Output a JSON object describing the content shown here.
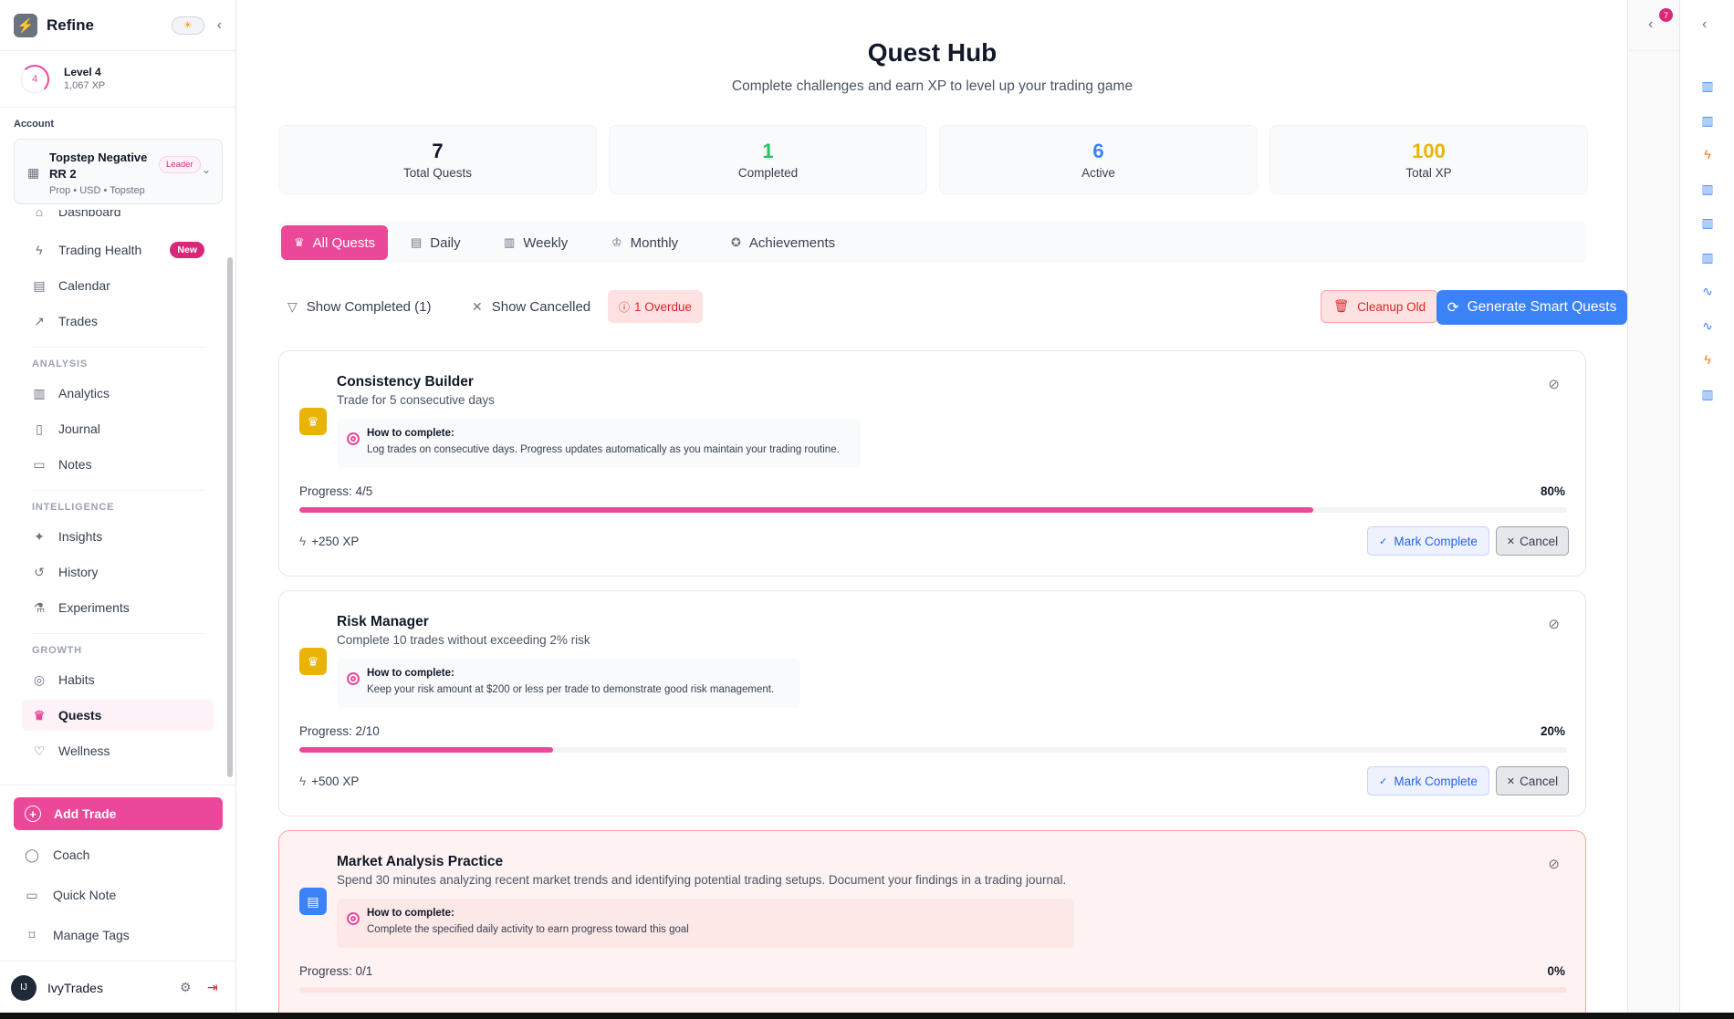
{
  "app": {
    "title": "Refine",
    "theme_icon": "sun-icon"
  },
  "user_level": {
    "ring_value": "4",
    "level": "Level 4",
    "xp": "1,067 XP"
  },
  "account": {
    "label": "Account",
    "name": "Topstep Negative RR 2",
    "badge": "Leader",
    "sub": "Prop • USD • Topstep"
  },
  "nav": {
    "main": [
      {
        "label": "Dashboard",
        "icon": "home-icon"
      },
      {
        "label": "Trading Health",
        "icon": "zap-icon",
        "badge": "New"
      },
      {
        "label": "Calendar",
        "icon": "calendar-icon"
      },
      {
        "label": "Trades",
        "icon": "trending-up-icon"
      }
    ],
    "analysis_title": "ANALYSIS",
    "analysis": [
      {
        "label": "Analytics",
        "icon": "bar-chart-icon"
      },
      {
        "label": "Journal",
        "icon": "book-icon"
      },
      {
        "label": "Notes",
        "icon": "file-icon"
      }
    ],
    "intelligence_title": "INTELLIGENCE",
    "intelligence": [
      {
        "label": "Insights",
        "icon": "sparkles-icon"
      },
      {
        "label": "History",
        "icon": "history-icon"
      },
      {
        "label": "Experiments",
        "icon": "flask-icon"
      }
    ],
    "growth_title": "GROWTH",
    "growth": [
      {
        "label": "Habits",
        "icon": "target-icon"
      },
      {
        "label": "Quests",
        "icon": "trophy-icon"
      },
      {
        "label": "Wellness",
        "icon": "heart-icon"
      }
    ]
  },
  "bottom": {
    "add_trade": "Add Trade",
    "coach": "Coach",
    "quick_note": "Quick Note",
    "manage_tags": "Manage Tags"
  },
  "user": {
    "name": "IvyTrades",
    "avatar": "IJ"
  },
  "header": {
    "title": "Quest Hub",
    "subtitle": "Complete challenges and earn XP to level up your trading game"
  },
  "stats": [
    {
      "value": "7",
      "label": "Total Quests",
      "color": "#111827"
    },
    {
      "value": "1",
      "label": "Completed",
      "color": "#22c55e"
    },
    {
      "value": "6",
      "label": "Active",
      "color": "#3b82f6"
    },
    {
      "value": "100",
      "label": "Total XP",
      "color": "#eab308"
    }
  ],
  "tabs": [
    {
      "label": "All Quests",
      "icon": "trophy-icon"
    },
    {
      "label": "Daily",
      "icon": "calendar-icon"
    },
    {
      "label": "Weekly",
      "icon": "bar-chart-icon"
    },
    {
      "label": "Monthly",
      "icon": "crown-icon"
    },
    {
      "label": "Achievements",
      "icon": "award-icon"
    }
  ],
  "filters": {
    "show_completed": "Show Completed (1)",
    "show_cancelled": "Show Cancelled",
    "overdue": "1 Overdue",
    "cleanup": "Cleanup Old",
    "generate": "Generate Smart Quests"
  },
  "quests": [
    {
      "title": "Consistency Builder",
      "description": "Trade for 5 consecutive days",
      "howto_title": "How to complete:",
      "howto_text": "Log trades on consecutive days. Progress updates automatically as you maintain your trading routine.",
      "progress_label": "Progress: 4/5",
      "progress_pct": "80%",
      "progress_value": 0.8,
      "xp": "+250 XP",
      "mark_complete": "Mark Complete",
      "cancel": "Cancel",
      "icon": "trophy-icon",
      "icon_color": "#eab308"
    },
    {
      "title": "Risk Manager",
      "description": "Complete 10 trades without exceeding 2% risk",
      "howto_title": "How to complete:",
      "howto_text": "Keep your risk amount at $200 or less per trade to demonstrate good risk management.",
      "progress_label": "Progress: 2/10",
      "progress_pct": "20%",
      "progress_value": 0.2,
      "xp": "+500 XP",
      "mark_complete": "Mark Complete",
      "cancel": "Cancel",
      "icon": "trophy-icon",
      "icon_color": "#eab308"
    },
    {
      "title": "Market Analysis Practice",
      "description": "Spend 30 minutes analyzing recent market trends and identifying potential trading setups. Document your findings in a trading journal.",
      "howto_title": "How to complete:",
      "howto_text": "Complete the specified daily activity to earn progress toward this goal",
      "progress_label": "Progress: 0/1",
      "progress_pct": "0%",
      "progress_value": 0,
      "icon": "calendar-icon",
      "icon_color": "#3b82f6"
    }
  ],
  "notifications": {
    "count": "7"
  },
  "right_rail_icons": [
    {
      "icon": "bar-chart-icon",
      "color": "#3b82f6"
    },
    {
      "icon": "bar-chart-icon",
      "color": "#3b82f6"
    },
    {
      "icon": "zap-icon",
      "color": "#f97316"
    },
    {
      "icon": "bar-chart-icon",
      "color": "#3b82f6"
    },
    {
      "icon": "bar-chart-icon",
      "color": "#3b82f6"
    },
    {
      "icon": "bar-chart-icon",
      "color": "#3b82f6"
    },
    {
      "icon": "activity-icon",
      "color": "#3b82f6"
    },
    {
      "icon": "activity-icon",
      "color": "#3b82f6"
    },
    {
      "icon": "zap-icon",
      "color": "#f97316"
    },
    {
      "icon": "bar-chart-icon",
      "color": "#3b82f6"
    }
  ]
}
